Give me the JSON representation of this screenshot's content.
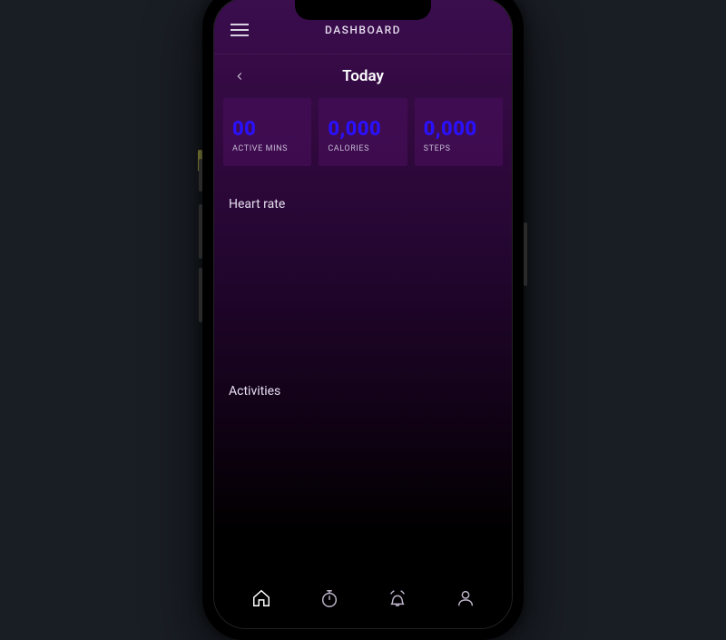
{
  "header": {
    "title": "DASHBOARD"
  },
  "dayNav": {
    "label": "Today"
  },
  "stats": [
    {
      "value": "00",
      "label": "ACTIVE MINS"
    },
    {
      "value": "0,000",
      "label": "CALORIES"
    },
    {
      "value": "0,000",
      "label": "STEPS"
    }
  ],
  "sections": {
    "heartRate": "Heart rate",
    "activities": "Activities"
  },
  "colors": {
    "accent": "#2a11ff",
    "bgTop": "#3a0d4d"
  },
  "tabs": [
    {
      "id": "home",
      "icon": "home-icon",
      "active": true
    },
    {
      "id": "timer",
      "icon": "stopwatch-icon",
      "active": false
    },
    {
      "id": "alerts",
      "icon": "bell-icon",
      "active": false
    },
    {
      "id": "profile",
      "icon": "user-icon",
      "active": false
    }
  ]
}
